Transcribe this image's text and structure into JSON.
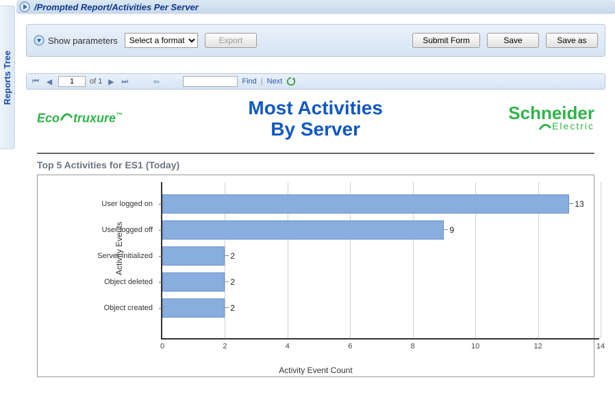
{
  "sidebar": {
    "label": "Reports Tree"
  },
  "breadcrumb": {
    "path": "/Prompted Report/Activities Per Server"
  },
  "params_bar": {
    "show_params_label": "Show parameters",
    "format_selected": "Select a format",
    "export_label": "Export",
    "submit_label": "Submit Form",
    "save_label": "Save",
    "saveas_label": "Save as"
  },
  "nav": {
    "page_value": "1",
    "of_label": "of 1",
    "find_label": "Find",
    "next_label": "Next"
  },
  "report": {
    "logo_left_a": "Eco",
    "logo_left_b": "truxure",
    "title_line1": "Most Activities",
    "title_line2": "By Server",
    "logo_right_a": "Schneider",
    "logo_right_b": "Electric"
  },
  "chart_title": "Top 5 Activities for ES1 (Today)",
  "chart_data": {
    "type": "bar",
    "orientation": "horizontal",
    "title": "Top 5 Activities for ES1 (Today)",
    "categories": [
      "User logged on",
      "User logged off",
      "Server initialized",
      "Object deleted",
      "Object created"
    ],
    "values": [
      13,
      9,
      2,
      2,
      2
    ],
    "xlabel": "Activity Event Count",
    "ylabel": "Activity Events",
    "xlim": [
      0,
      14
    ],
    "xticks": [
      0,
      2,
      4,
      6,
      8,
      10,
      12,
      14
    ]
  }
}
